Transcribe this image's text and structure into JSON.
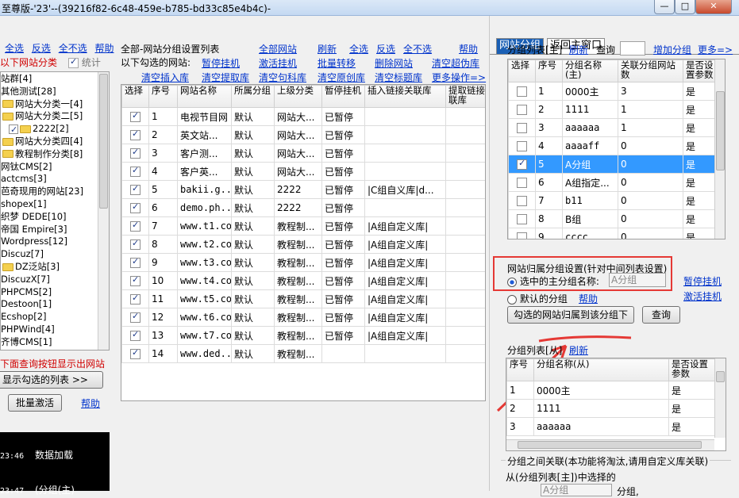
{
  "window": {
    "title": "至尊版-'23'--(39216f82-6c48-459e-b785-bd33c85e4b4c)-",
    "min": "—",
    "max": "□",
    "close": "✕"
  },
  "left": {
    "links": [
      "全选",
      "反选",
      "全不选",
      "帮助"
    ],
    "heading": "以下网站分类",
    "stats_label": "统计",
    "tree": [
      {
        "label": "站群[4]",
        "folder": false,
        "check": false
      },
      {
        "label": "其他测试[28]",
        "folder": false,
        "check": false
      },
      {
        "label": "网站大分类一[4]",
        "folder": true,
        "check": false
      },
      {
        "label": "网站大分类二[5]",
        "folder": true,
        "check": false
      },
      {
        "label": "2222[2]",
        "folder": true,
        "check": true
      },
      {
        "label": "网站大分类四[4]",
        "folder": true,
        "check": false
      },
      {
        "label": "教程制作分类[8]",
        "folder": true,
        "check": false
      },
      {
        "label": "网钛CMS[2]",
        "folder": false,
        "check": false
      },
      {
        "label": "actcms[3]",
        "folder": false,
        "check": false
      },
      {
        "label": "芭奇现用的网站[23]",
        "folder": false,
        "check": false
      },
      {
        "label": "shopex[1]",
        "folder": false,
        "check": false
      },
      {
        "label": "织梦 DEDE[10]",
        "folder": false,
        "check": false
      },
      {
        "label": "帝国 Empire[3]",
        "folder": false,
        "check": false
      },
      {
        "label": "Wordpress[12]",
        "folder": false,
        "check": false
      },
      {
        "label": "Discuz[7]",
        "folder": false,
        "check": false
      },
      {
        "label": "DZ泛站[3]",
        "folder": true,
        "check": false
      },
      {
        "label": "DiscuzX[7]",
        "folder": false,
        "check": false
      },
      {
        "label": "PHPCMS[2]",
        "folder": false,
        "check": false
      },
      {
        "label": "Destoon[1]",
        "folder": false,
        "check": false
      },
      {
        "label": "Ecshop[2]",
        "folder": false,
        "check": false
      },
      {
        "label": "PHPWind[4]",
        "folder": false,
        "check": false
      },
      {
        "label": "齐博CMS[1]",
        "folder": false,
        "check": false
      }
    ],
    "hint": "下面查询按钮显示出网站",
    "show_btn": "显示勾选的列表 >>",
    "batch_btn": "批量激活",
    "help": "帮助",
    "log": [
      {
        "time": "23:46",
        "text": "数据加载"
      },
      {
        "time": "23:47",
        "text": "(分组(主)"
      }
    ]
  },
  "middle": {
    "title": "全部-网站分组设置列表",
    "top_links": [
      "全部网站",
      "刷新",
      "全选",
      "反选",
      "全不选",
      "帮助"
    ],
    "selected_label": "以下勾选的网站:",
    "row2": [
      "暂停挂机",
      "激活挂机",
      "批量转移",
      "删除网站",
      "清空超伪库"
    ],
    "row3": [
      "清空插入库",
      "清空提取库",
      "清空句科库",
      "清空原创库",
      "清空标题库",
      "更多操作=>"
    ],
    "columns": [
      "选择",
      "序号",
      "网站名称",
      "所属分组",
      "上级分类",
      "暂停挂机",
      "插入链接关联库",
      "提取链接关联库"
    ],
    "rows": [
      [
        "1",
        "电视节目网",
        "默认",
        "网站大...",
        "已暂停",
        "",
        ""
      ],
      [
        "2",
        "英文站...",
        "默认",
        "网站大...",
        "已暂停",
        "",
        ""
      ],
      [
        "3",
        "客户测...",
        "默认",
        "网站大...",
        "已暂停",
        "",
        ""
      ],
      [
        "4",
        "客户英...",
        "默认",
        "网站大...",
        "已暂停",
        "",
        ""
      ],
      [
        "5",
        "bakii.g...",
        "默认",
        "2222",
        "已暂停",
        "|C组自义库|d...",
        ""
      ],
      [
        "6",
        "demo.ph...",
        "默认",
        "2222",
        "已暂停",
        "",
        ""
      ],
      [
        "7",
        "www.t1.com",
        "默认",
        "教程制...",
        "已暂停",
        "|A组自定义库|",
        ""
      ],
      [
        "8",
        "www.t2.com",
        "默认",
        "教程制...",
        "已暂停",
        "|A组自定义库|",
        ""
      ],
      [
        "9",
        "www.t3.com",
        "默认",
        "教程制...",
        "已暂停",
        "|A组自定义库|",
        ""
      ],
      [
        "10",
        "www.t4.com",
        "默认",
        "教程制...",
        "已暂停",
        "|A组自定义库|",
        ""
      ],
      [
        "11",
        "www.t5.com",
        "默认",
        "教程制...",
        "已暂停",
        "|A组自定义库|",
        ""
      ],
      [
        "12",
        "www.t6.com",
        "默认",
        "教程制...",
        "已暂停",
        "|A组自定义库|",
        ""
      ],
      [
        "13",
        "www.t7.com",
        "默认",
        "教程制...",
        "已暂停",
        "|A组自定义库|",
        ""
      ],
      [
        "14",
        "www.ded...",
        "默认",
        "教程制...",
        "",
        "",
        ""
      ]
    ]
  },
  "right": {
    "tabs": [
      "网站分组",
      "返回主窗口"
    ],
    "main_list_label": "分组列表[主]",
    "refresh": "刷新",
    "query": "查询",
    "add_group": "增加分组",
    "more": "更多=>",
    "main_columns": [
      "选择",
      "序号",
      "分组名称(主)",
      "关联分组网站数",
      "是否设置参数"
    ],
    "main_rows": [
      {
        "no": "1",
        "name": "0000主",
        "count": "3",
        "set": "是",
        "checked": false
      },
      {
        "no": "2",
        "name": "1111",
        "count": "1",
        "set": "是",
        "checked": false
      },
      {
        "no": "3",
        "name": "aaaaaa",
        "count": "1",
        "set": "是",
        "checked": false
      },
      {
        "no": "4",
        "name": "aaaaff",
        "count": "0",
        "set": "是",
        "checked": false
      },
      {
        "no": "5",
        "name": "A分组",
        "count": "0",
        "set": "是",
        "checked": true
      },
      {
        "no": "6",
        "name": "A组指定...",
        "count": "0",
        "set": "是",
        "checked": false
      },
      {
        "no": "7",
        "name": "b11",
        "count": "0",
        "set": "是",
        "checked": false
      },
      {
        "no": "8",
        "name": "B组",
        "count": "0",
        "set": "是",
        "checked": false
      },
      {
        "no": "9",
        "name": "cccc",
        "count": "0",
        "set": "是",
        "checked": false
      }
    ],
    "assign_title": "网站归属分组设置(针对中间列表设置)",
    "radio_selected": "选中的主分组名称:",
    "selected_group": "A分组",
    "radio_default": "默认的分组",
    "help": "帮助",
    "pause": "暂停挂机",
    "activate": "激活挂机",
    "assign_btn": "勾选的网站归属到该分组下",
    "query_btn": "查询",
    "sub_list_label": "分组列表[从]",
    "sub_refresh": "刷新",
    "sub_columns": [
      "序号",
      "分组名称(从)",
      "是否设置参数"
    ],
    "sub_rows": [
      [
        "1",
        "0000主",
        "是"
      ],
      [
        "2",
        "1111",
        "是"
      ],
      [
        "3",
        "aaaaaa",
        "是"
      ]
    ],
    "relation_title": "分组之间关联(本功能将淘汰,请用自定义库关联)",
    "relation_from": "从(分组列表[主])中选择的",
    "relation_value": "A分组",
    "relation_suffix": "分组,"
  },
  "colors": {
    "accent": "#3399ff",
    "highlight": "#e53935",
    "tab": "#1a5fb4",
    "link": "#0033cc"
  }
}
